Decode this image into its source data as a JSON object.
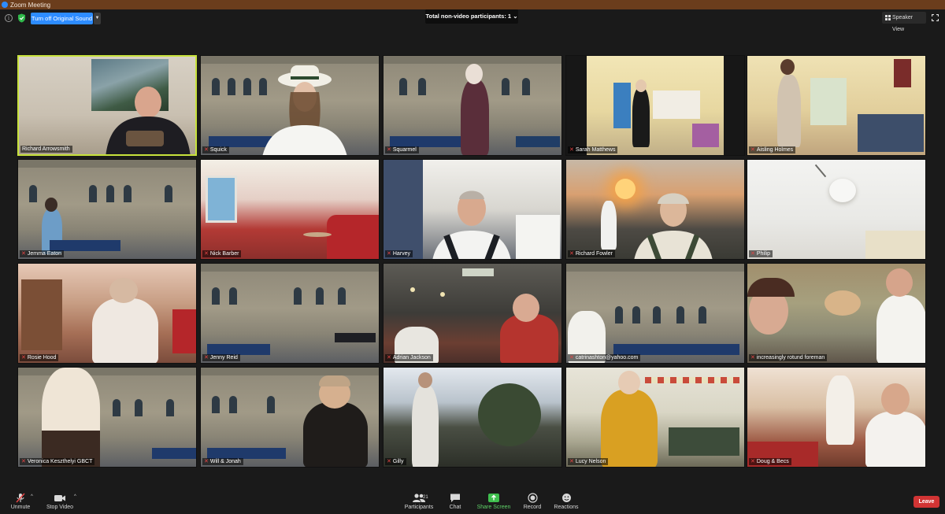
{
  "window": {
    "title": "Zoom Meeting"
  },
  "toolbar": {
    "original_sound_label": "Turn off Original Sound",
    "non_video_label": "Total non-video participants: 1",
    "non_video_caret": "⌄",
    "speaker_view_label": "Speaker View"
  },
  "participants": [
    {
      "name": "Richard Arrowsmith",
      "muted": false,
      "active": true
    },
    {
      "name": "Squick",
      "muted": true
    },
    {
      "name": "Squarmel",
      "muted": true
    },
    {
      "name": "Sarah Matthews",
      "muted": true
    },
    {
      "name": "Aisling Holmes",
      "muted": true
    },
    {
      "name": "Jemma Eaton",
      "muted": true
    },
    {
      "name": "Nick Barber",
      "muted": true
    },
    {
      "name": "Harvey",
      "muted": true
    },
    {
      "name": "Richard Fowler",
      "muted": true
    },
    {
      "name": "Philip",
      "muted": true
    },
    {
      "name": "Rosie Hood",
      "muted": true
    },
    {
      "name": "Jenny Reid",
      "muted": true
    },
    {
      "name": "Adrian Jackson",
      "muted": true
    },
    {
      "name": "catrinashton@yahoo.com",
      "muted": true
    },
    {
      "name": "increasingly rotund foreman",
      "muted": true
    },
    {
      "name": "Veronica Keszthelyi GBCT",
      "muted": true
    },
    {
      "name": "Will & Jonah",
      "muted": true
    },
    {
      "name": "Gilly",
      "muted": true
    },
    {
      "name": "Lucy Nelson",
      "muted": true
    },
    {
      "name": "Doug & Becs",
      "muted": true
    }
  ],
  "controls": {
    "unmute": "Unmute",
    "stop_video": "Stop Video",
    "participants": "Participants",
    "participants_count": "21",
    "chat": "Chat",
    "share_screen": "Share Screen",
    "record": "Record",
    "reactions": "Reactions",
    "leave": "Leave"
  },
  "colors": {
    "titlebar": "#6b3d1c",
    "accent_blue": "#2d8cff",
    "active_speaker_border": "#c8e23c",
    "share_green": "#5fd068",
    "leave_red": "#d13434",
    "muted_mic": "#e54545"
  }
}
